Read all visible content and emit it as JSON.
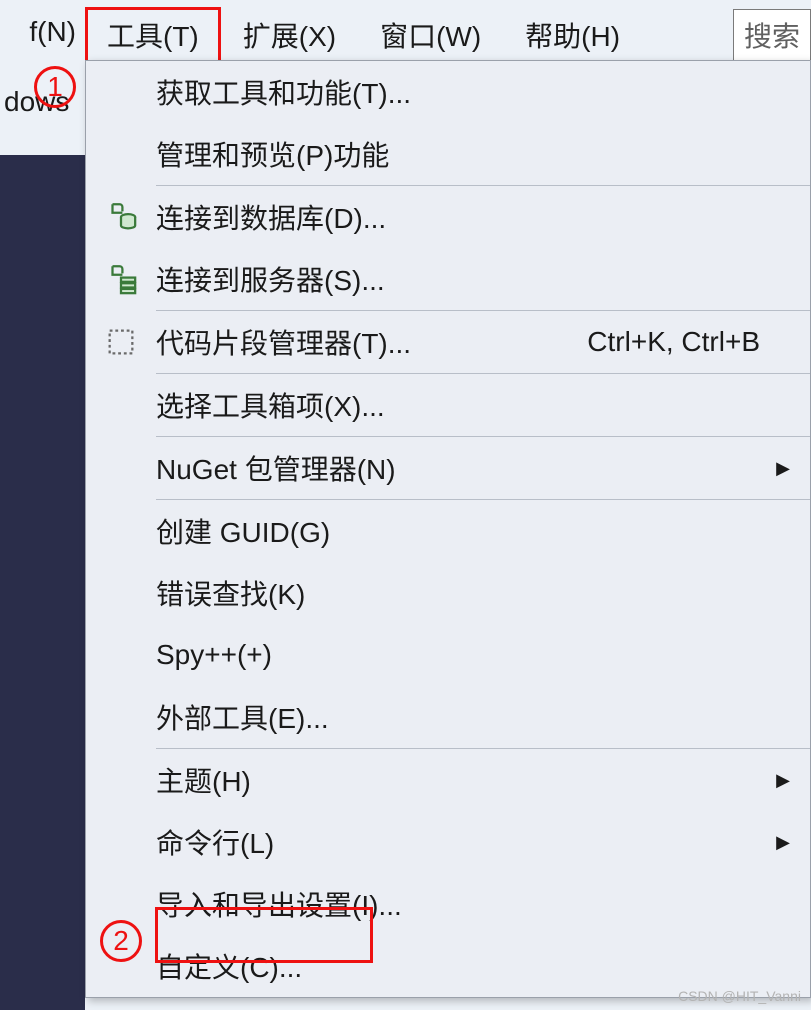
{
  "menubar": {
    "fragment_left": "f(N)",
    "items": [
      {
        "label": "工具(T)",
        "active": true
      },
      {
        "label": "扩展(X)"
      },
      {
        "label": "窗口(W)"
      },
      {
        "label": "帮助(H)"
      }
    ],
    "search_placeholder": "搜索"
  },
  "toolbar_fragment": "dows",
  "callouts": {
    "one": "1",
    "two": "2"
  },
  "dropdown": {
    "groups": [
      [
        {
          "icon": "",
          "label": "获取工具和功能(T)..."
        },
        {
          "icon": "",
          "label": "管理和预览(P)功能"
        }
      ],
      [
        {
          "icon": "db",
          "label": "连接到数据库(D)..."
        },
        {
          "icon": "server",
          "label": "连接到服务器(S)..."
        }
      ],
      [
        {
          "icon": "snippet",
          "label": "代码片段管理器(T)...",
          "shortcut": "Ctrl+K, Ctrl+B"
        }
      ],
      [
        {
          "icon": "",
          "label": "选择工具箱项(X)..."
        }
      ],
      [
        {
          "icon": "",
          "label": "NuGet 包管理器(N)",
          "submenu": true
        }
      ],
      [
        {
          "icon": "",
          "label": "创建 GUID(G)"
        },
        {
          "icon": "",
          "label": "错误查找(K)"
        },
        {
          "icon": "",
          "label": "Spy++(+)"
        },
        {
          "icon": "",
          "label": "外部工具(E)..."
        }
      ],
      [
        {
          "icon": "",
          "label": "主题(H)",
          "submenu": true
        },
        {
          "icon": "",
          "label": "命令行(L)",
          "submenu": true
        },
        {
          "icon": "",
          "label": "导入和导出设置(I)..."
        },
        {
          "icon": "",
          "label": "自定义(C)..."
        }
      ]
    ]
  },
  "watermark": "CSDN @HIT_Vanni"
}
